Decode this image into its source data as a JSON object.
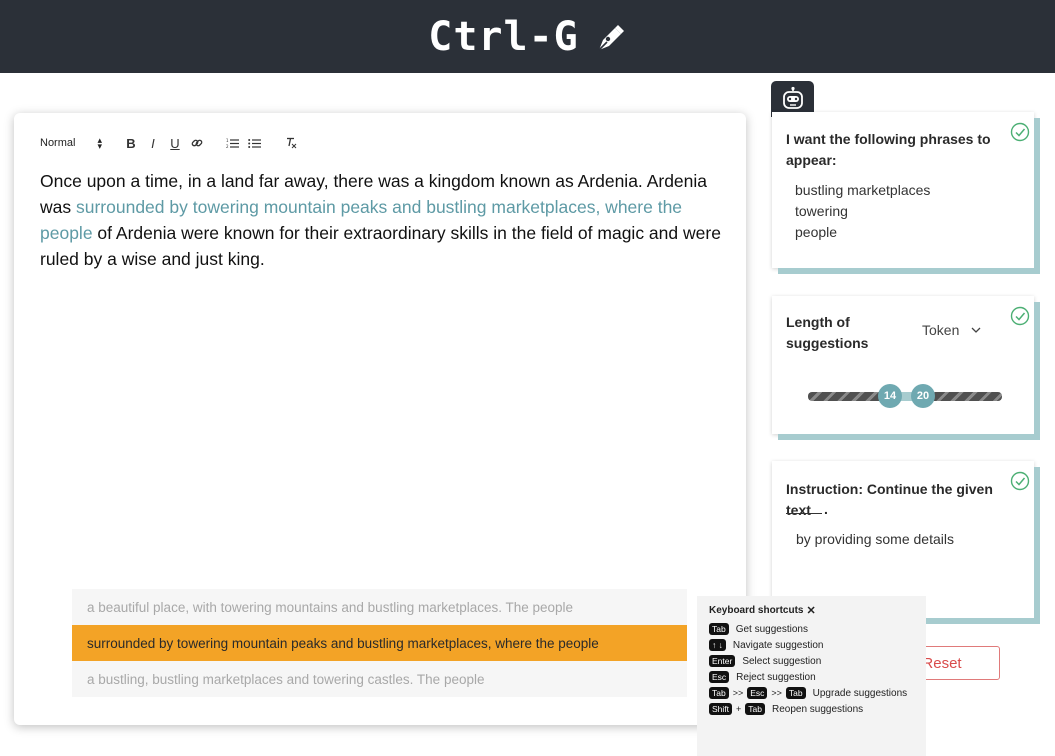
{
  "app": {
    "title": "Ctrl-G",
    "logo_icon": "pen-icon"
  },
  "toolbar": {
    "format": "Normal",
    "buttons": [
      "B",
      "I",
      "U",
      "link-icon",
      "ordered-list-icon",
      "bullet-list-icon",
      "clear-format-icon"
    ]
  },
  "editor": {
    "text_before": "Once upon a time, in a land far away, there was a kingdom known as Ardenia. Ardenia was ",
    "accepted_text": "surrounded by towering mountain peaks and bustling marketplaces, where the people",
    "text_after": " of Ardenia were known for their extraordinary skills in the field of magic and were ruled by a wise and just king."
  },
  "suggestions": [
    "a beautiful place, with towering mountains and bustling marketplaces. The people",
    "surrounded by towering mountain peaks and bustling marketplaces, where the people",
    "a bustling, bustling marketplaces and towering castles. The people"
  ],
  "selected_suggestion_index": 1,
  "panels": {
    "phrases": {
      "title": "I want the following phrases to appear:",
      "items": [
        "bustling marketplaces",
        "towering",
        "people"
      ]
    },
    "length": {
      "title": "Length of suggestions",
      "unit": "Token",
      "min": 14,
      "max": 20
    },
    "instruction": {
      "title": "Instruction: Continue the given text",
      "blank_suffix": ".",
      "text": "by providing some details"
    }
  },
  "reset_label": "Reset",
  "shortcuts": {
    "title": "Keyboard shortcuts",
    "close": "✕",
    "rows": [
      {
        "keys": [
          "Tab"
        ],
        "label": "Get suggestions"
      },
      {
        "keys": [
          "↑",
          "↓"
        ],
        "label": "Navigate suggestion"
      },
      {
        "keys": [
          "Enter"
        ],
        "label": "Select suggestion"
      },
      {
        "keys": [
          "Esc"
        ],
        "label": "Reject suggestion"
      },
      {
        "keys": [
          "Tab",
          ">>",
          "Esc",
          ">>",
          "Tab"
        ],
        "label": "Upgrade suggestions"
      },
      {
        "keys": [
          "Shift",
          "+",
          "Tab"
        ],
        "label": "Reopen suggestions"
      }
    ]
  },
  "colors": {
    "header": "#2b3038",
    "accent_teal": "#5e9aa5",
    "selected_suggestion": "#f3a326",
    "reset": "#d94b4b"
  }
}
